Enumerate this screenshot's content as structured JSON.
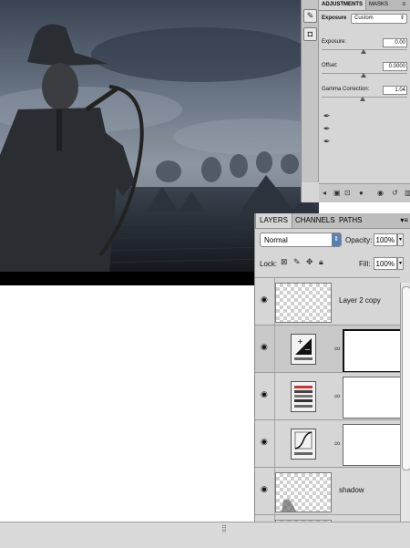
{
  "adjustments_panel": {
    "tabs": [
      "ADJUSTMENTS",
      "MASKS"
    ],
    "adjustment_type": "Exposure",
    "preset": "Custom",
    "fields": [
      {
        "label": "Exposure:",
        "value": "0.00"
      },
      {
        "label": "Offset:",
        "value": "0.0000"
      },
      {
        "label": "Gamma Correction:",
        "value": "1.04"
      }
    ]
  },
  "layers_panel": {
    "tabs": [
      "LAYERS",
      "CHANNELS",
      "PATHS"
    ],
    "blend_mode": "Normal",
    "opacity_label": "Opacity:",
    "opacity": "100%",
    "lock_label": "Lock:",
    "fill_label": "Fill:",
    "fill": "100%",
    "layers": [
      {
        "name": "Layer 2 copy",
        "kind": "pixel"
      },
      {
        "name": "",
        "kind": "adjustment-exposure"
      },
      {
        "name": "",
        "kind": "adjustment-levels"
      },
      {
        "name": "",
        "kind": "adjustment-curves"
      },
      {
        "name": "shadow",
        "kind": "pixel"
      }
    ]
  },
  "colors": {
    "panel_bg": "#d6d6d6",
    "scene_sky": "#5c6a7c",
    "scene_ground": "#1c2127",
    "select_arrow": "#5b7fb0"
  }
}
